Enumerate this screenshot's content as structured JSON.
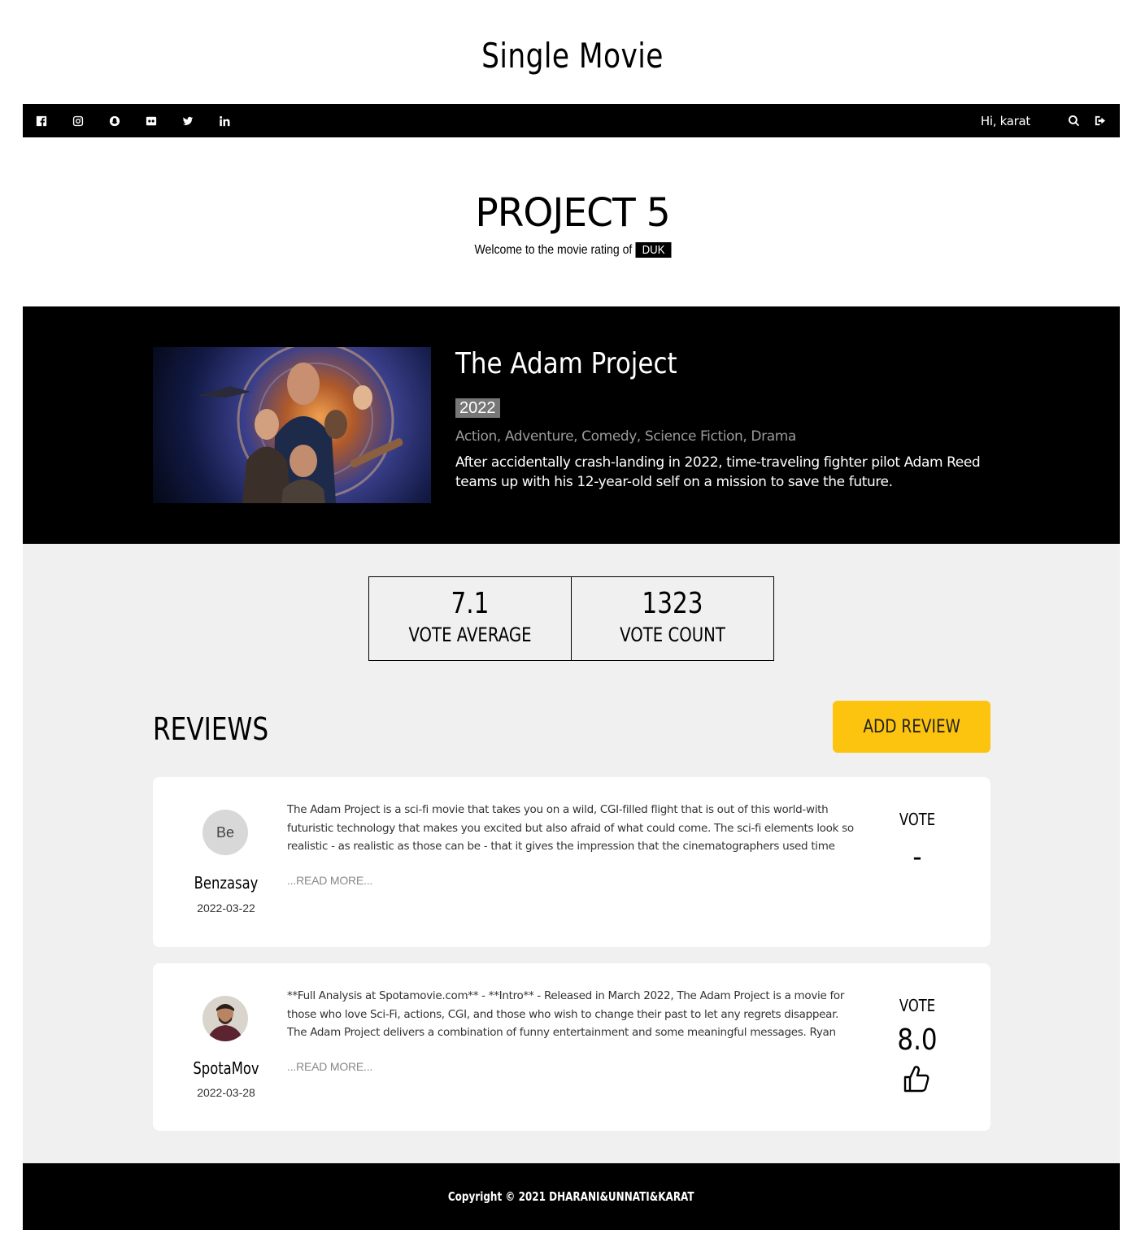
{
  "page": {
    "title": "Single Movie"
  },
  "topbar": {
    "social_icons": [
      "facebook-icon",
      "instagram-icon",
      "snapchat-icon",
      "flickr-icon",
      "twitter-icon",
      "linkedin-icon"
    ],
    "greeting": "Hi, karat",
    "tools": [
      "search-icon",
      "logout-icon"
    ]
  },
  "brand": {
    "name": "PROJECT 5",
    "welcome": "Welcome to the movie rating of",
    "tag": "DUK"
  },
  "movie": {
    "title": "The Adam Project",
    "year": "2022",
    "genres": "Action, Adventure, Comedy, Science Fiction, Drama",
    "overview": "After accidentally crash-landing in 2022, time-traveling fighter pilot Adam Reed teams up with his 12-year-old self on a mission to save the future."
  },
  "stats": {
    "vote_average": "7.1",
    "vote_average_label": "VOTE AVERAGE",
    "vote_count": "1323",
    "vote_count_label": "VOTE COUNT"
  },
  "reviews": {
    "heading": "REVIEWS",
    "add_button": "ADD REVIEW",
    "items": [
      {
        "avatar_text": "Be",
        "author": "Benzasay",
        "date": "2022-03-22",
        "content": "The Adam Project is a sci-fi movie that takes you on a wild, CGI-filled flight that is out of this world-with futuristic technology that makes you excited but also afraid of what could come. The sci-fi elements look so realistic - as realistic as those can be - that it gives the impression that the cinematographers used time",
        "read_more": "...READ MORE...",
        "vote_label": "VOTE",
        "vote": "-"
      },
      {
        "avatar_text": "",
        "author": "SpotaMov",
        "date": "2022-03-28",
        "content": "**Full Analysis at Spotamovie.com** - **Intro** - Released in March 2022, The Adam Project is a movie for those who love Sci-Fi, actions, CGI, and those who wish to change their past to let any regrets disappear. The Adam Project delivers a combination of funny entertainment and some meaningful messages. Ryan",
        "read_more": "...READ MORE...",
        "vote_label": "VOTE",
        "vote": "8.0"
      }
    ]
  },
  "footer": {
    "copyright": "Copyright © 2021 DHARANI&UNNATI&KARAT"
  }
}
